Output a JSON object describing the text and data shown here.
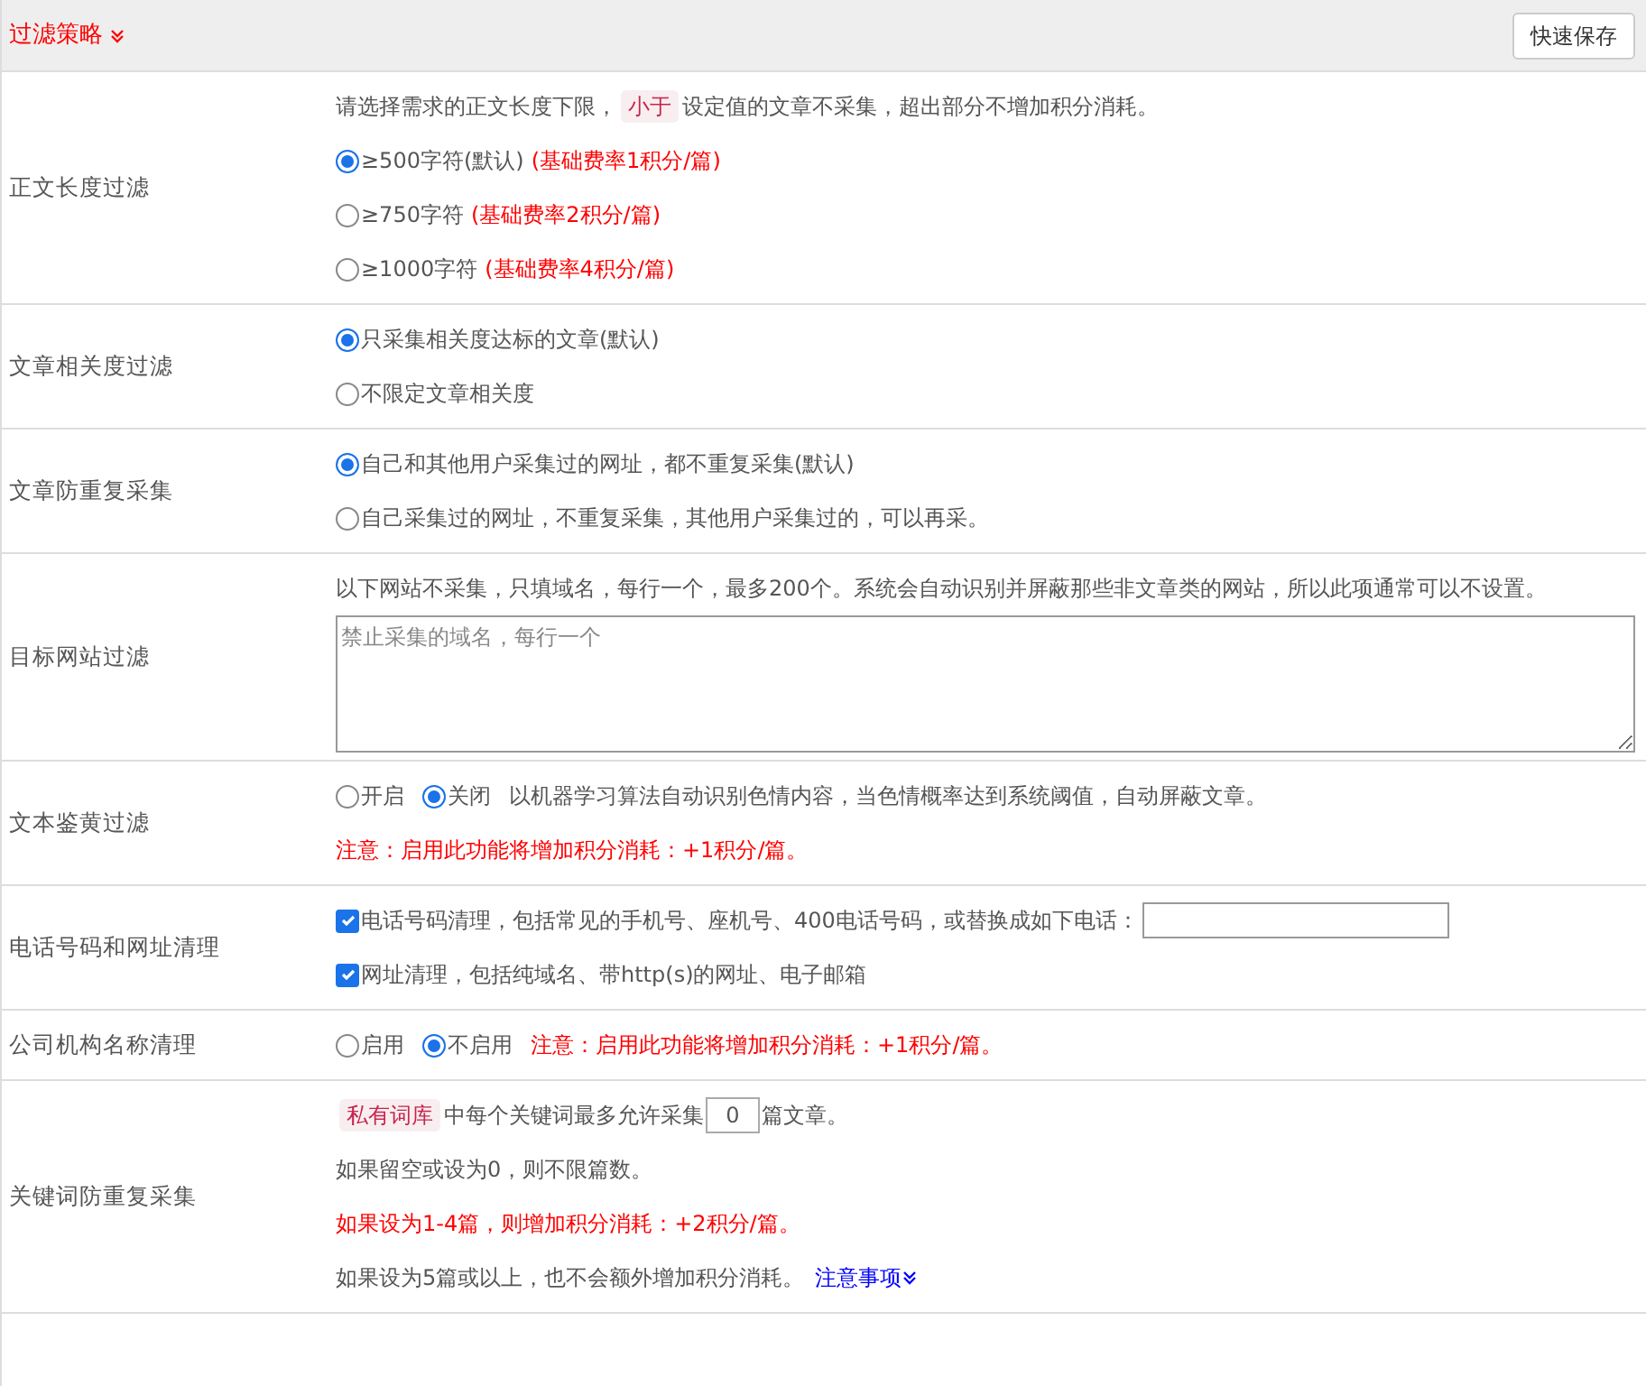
{
  "header": {
    "title": "过滤策略",
    "save_button": "快速保存"
  },
  "rows": [
    {
      "label": "正文长度过滤",
      "lines": [
        {
          "kind": "note",
          "parts": [
            {
              "text": "请选择需求的正文长度下限，"
            },
            {
              "text": "小于",
              "tag": true
            },
            {
              "text": "设定值的文章不采集，超出部分不增加积分消耗。"
            }
          ]
        },
        {
          "kind": "radio",
          "selected": true,
          "text": "≥500字符(默认)",
          "extra": "(基础费率1积分/篇)"
        },
        {
          "kind": "radio",
          "selected": false,
          "text": "≥750字符",
          "extra": "(基础费率2积分/篇)"
        },
        {
          "kind": "radio",
          "selected": false,
          "text": "≥1000字符",
          "extra": "(基础费率4积分/篇)"
        }
      ]
    },
    {
      "label": "文章相关度过滤",
      "lines": [
        {
          "kind": "radio",
          "selected": true,
          "text": "只采集相关度达标的文章(默认)"
        },
        {
          "kind": "radio",
          "selected": false,
          "text": "不限定文章相关度"
        }
      ]
    },
    {
      "label": "文章防重复采集",
      "lines": [
        {
          "kind": "radio",
          "selected": true,
          "text": "自己和其他用户采集过的网址，都不重复采集(默认)"
        },
        {
          "kind": "radio",
          "selected": false,
          "text": "自己采集过的网址，不重复采集，其他用户采集过的，可以再采。"
        }
      ]
    },
    {
      "label": "目标网站过滤",
      "lines": [
        {
          "kind": "note",
          "parts": [
            {
              "text": "以下网站不采集，只填域名，每行一个，最多200个。系统会自动识别并屏蔽那些非文章类的网站，所以此项通常可以不设置。"
            }
          ]
        },
        {
          "kind": "textarea",
          "placeholder": "禁止采集的域名，每行一个"
        }
      ]
    },
    {
      "label": "文本鉴黄过滤",
      "lines": [
        {
          "kind": "radio_group",
          "options": [
            {
              "text": "开启",
              "selected": false
            },
            {
              "text": "关闭",
              "selected": true
            }
          ],
          "text": "以机器学习算法自动识别色情内容，当色情概率达到系统阈值，自动屏蔽文章。"
        },
        {
          "kind": "warning",
          "text": "注意：启用此功能将增加积分消耗：+1积分/篇。"
        }
      ]
    },
    {
      "label": "电话号码和网址清理",
      "lines": [
        {
          "kind": "checkbox",
          "checked": true,
          "text": "电话号码清理，包括常见的手机号、座机号、400电话号码，或替换成如下电话：",
          "input": true
        },
        {
          "kind": "checkbox",
          "checked": true,
          "text": "网址清理，包括纯域名、带http(s)的网址、电子邮箱"
        }
      ]
    },
    {
      "label": "公司机构名称清理",
      "lines": [
        {
          "kind": "radio_group",
          "options": [
            {
              "text": "启用",
              "selected": false
            },
            {
              "text": "不启用",
              "selected": true
            }
          ],
          "warning": "注意：启用此功能将增加积分消耗：+1积分/篇。"
        }
      ]
    },
    {
      "label": "关键词防重复采集",
      "lines": [
        {
          "kind": "note",
          "parts": [
            {
              "text": "私有词库",
              "tag": true
            },
            {
              "text": "中每个关键词最多允许采集"
            },
            {
              "input": "0"
            },
            {
              "text": "篇文章。"
            }
          ]
        },
        {
          "kind": "note",
          "parts": [
            {
              "text": "如果留空或设为0，则不限篇数。"
            }
          ]
        },
        {
          "kind": "warning",
          "text": "如果设为1-4篇，则增加积分消耗：+2积分/篇。"
        },
        {
          "kind": "note",
          "parts": [
            {
              "text": "如果设为5篇或以上，也不会额外增加积分消耗。"
            },
            {
              "link": "注意事项"
            }
          ]
        }
      ]
    }
  ]
}
